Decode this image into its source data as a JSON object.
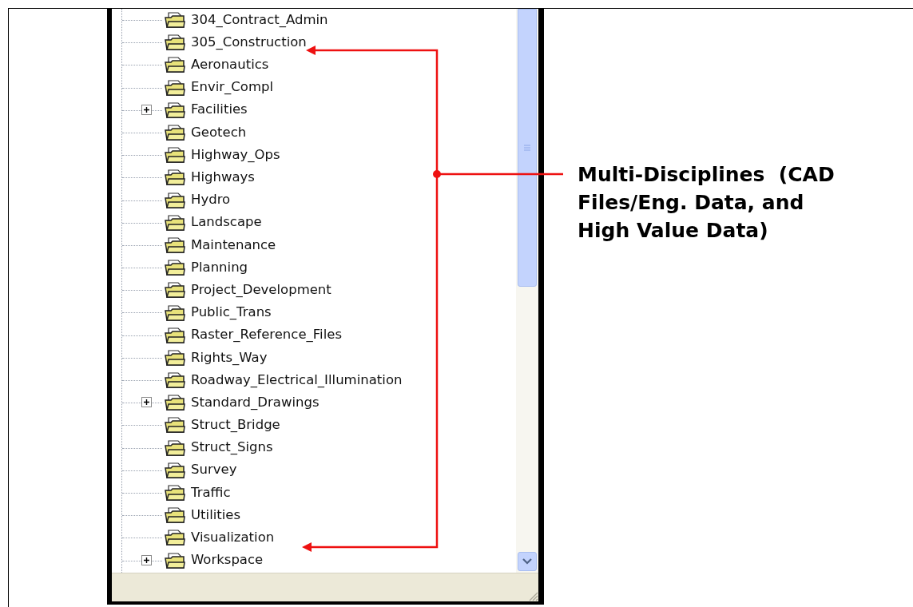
{
  "tree": {
    "items": [
      {
        "label": "304_Contract_Admin",
        "expandable": false
      },
      {
        "label": "305_Construction",
        "expandable": false
      },
      {
        "label": "Aeronautics",
        "expandable": false
      },
      {
        "label": "Envir_Compl",
        "expandable": false
      },
      {
        "label": "Facilities",
        "expandable": true
      },
      {
        "label": "Geotech",
        "expandable": false
      },
      {
        "label": "Highway_Ops",
        "expandable": false
      },
      {
        "label": "Highways",
        "expandable": false
      },
      {
        "label": "Hydro",
        "expandable": false
      },
      {
        "label": "Landscape",
        "expandable": false
      },
      {
        "label": "Maintenance",
        "expandable": false
      },
      {
        "label": "Planning",
        "expandable": false
      },
      {
        "label": "Project_Development",
        "expandable": false
      },
      {
        "label": "Public_Trans",
        "expandable": false
      },
      {
        "label": "Raster_Reference_Files",
        "expandable": false
      },
      {
        "label": "Rights_Way",
        "expandable": false
      },
      {
        "label": "Roadway_Electrical_Illumination",
        "expandable": false
      },
      {
        "label": "Standard_Drawings",
        "expandable": true
      },
      {
        "label": "Struct_Bridge",
        "expandable": false
      },
      {
        "label": "Struct_Signs",
        "expandable": false
      },
      {
        "label": "Survey",
        "expandable": false
      },
      {
        "label": "Traffic",
        "expandable": false
      },
      {
        "label": "Utilities",
        "expandable": false
      },
      {
        "label": "Visualization",
        "expandable": false
      },
      {
        "label": "Workspace",
        "expandable": true
      }
    ]
  },
  "annotation": {
    "lines": [
      "Multi-Disciplines  (CAD",
      "Files/Eng. Data, and",
      "High Value Data)"
    ]
  }
}
